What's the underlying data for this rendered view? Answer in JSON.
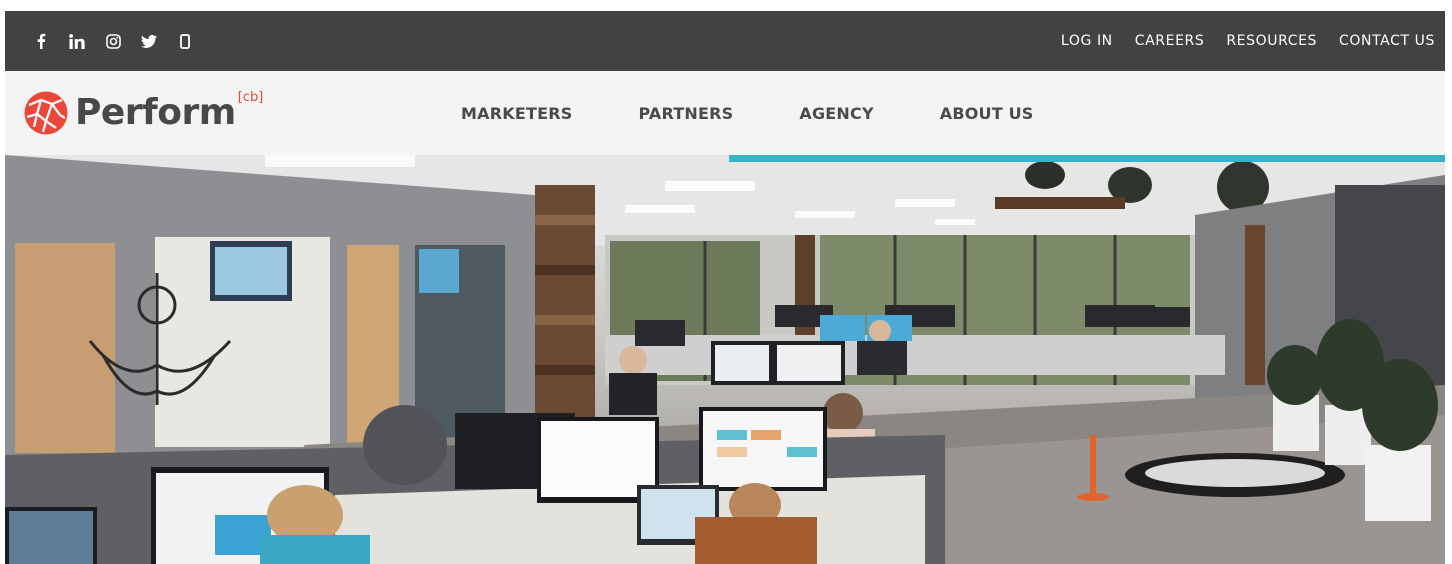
{
  "topbar": {
    "social_icons": [
      "facebook-icon",
      "linkedin-icon",
      "instagram-icon",
      "twitter-icon",
      "mobile-icon"
    ],
    "links": [
      "LOG IN",
      "CAREERS",
      "RESOURCES",
      "CONTACT US"
    ],
    "bg_color": "#424143"
  },
  "brand": {
    "name": "Perform",
    "superscript": "[cb]",
    "mark_color": "#e8473a"
  },
  "nav": {
    "items": [
      "MARKETERS",
      "PARTNERS",
      "AGENCY",
      "ABOUT US"
    ],
    "accent_color": "#37b4c8"
  },
  "hero": {
    "image": "open-plan-office-photo"
  }
}
